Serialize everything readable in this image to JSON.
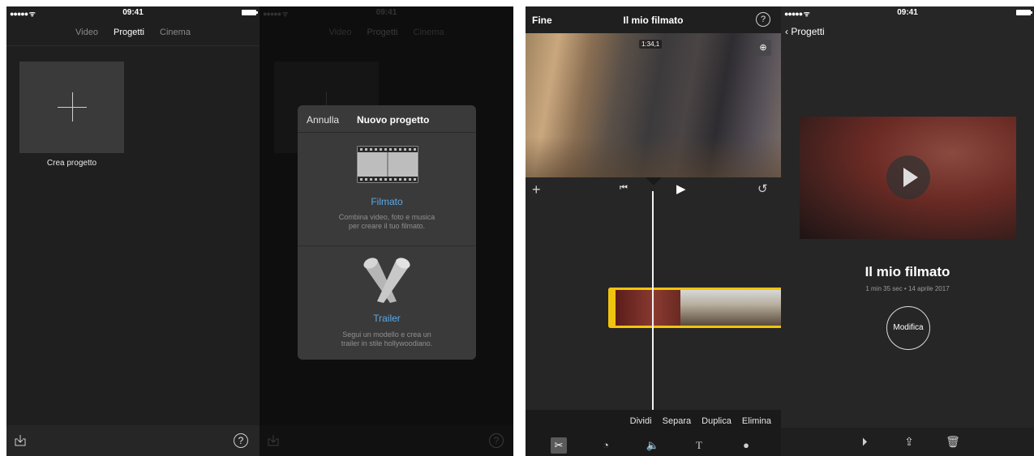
{
  "status": {
    "time": "09:41",
    "signal": "●●●●● ᯤ"
  },
  "screen1": {
    "tabs": [
      "Video",
      "Progetti",
      "Cinema"
    ],
    "create_label": "Crea progetto",
    "help_glyph": "?"
  },
  "screen2": {
    "tabs": [
      "Video",
      "Progetti",
      "Cinema"
    ],
    "cancel": "Annulla",
    "title": "Nuovo progetto",
    "movie": {
      "name": "Filmato",
      "desc1": "Combina video, foto e musica",
      "desc2": "per creare il tuo filmato."
    },
    "trailer": {
      "name": "Trailer",
      "desc1": "Segui un modello e crea un",
      "desc2": "trailer in stile hollywoodiano."
    },
    "help_glyph": "?"
  },
  "screen3": {
    "done": "Fine",
    "title": "Il mio filmato",
    "help_glyph": "?",
    "timecode": "1:34,1",
    "actions": [
      "Dividi",
      "Separa",
      "Duplica",
      "Elimina"
    ],
    "tools": [
      "scissors-icon",
      "speed-icon",
      "volume-icon",
      "title-icon",
      "filter-icon"
    ]
  },
  "screen4": {
    "back": "Progetti",
    "project_title": "Il mio filmato",
    "meta": "1 min 35 sec • 14 aprile 2017",
    "edit": "Modifica"
  }
}
